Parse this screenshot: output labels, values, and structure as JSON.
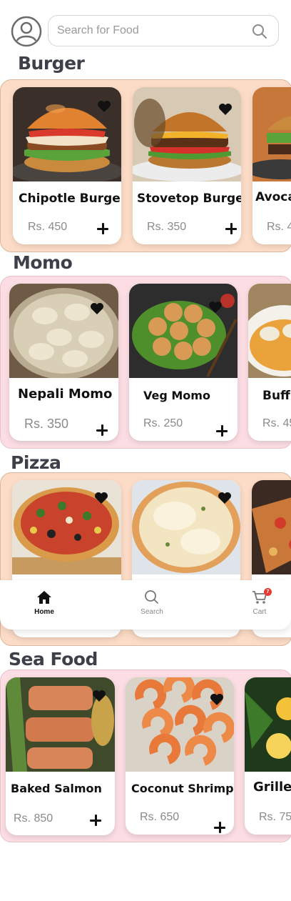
{
  "header": {
    "avatar_icon": "user-circle-icon",
    "search_placeholder": "Search for Food",
    "search_icon": "search-icon"
  },
  "sections": [
    {
      "title": "Burger",
      "items": [
        {
          "name": "Chipotle Burger",
          "price": "Rs. 450"
        },
        {
          "name": "Stovetop Burger",
          "price": "Rs. 350"
        },
        {
          "name": "Avoca",
          "price": "Rs. 4"
        }
      ]
    },
    {
      "title": "Momo",
      "items": [
        {
          "name": "Nepali Momo",
          "price": "Rs. 350"
        },
        {
          "name": "Veg Momo",
          "price": "Rs. 250"
        },
        {
          "name": "Buff",
          "price": "Rs. 45"
        }
      ]
    },
    {
      "title": "Pizza",
      "items": [
        {
          "name": "",
          "price": ""
        },
        {
          "name": "",
          "price": ""
        },
        {
          "name": "",
          "price": ""
        }
      ]
    },
    {
      "title": "Sea Food",
      "items": [
        {
          "name": "Baked Salmon",
          "price": "Rs. 850"
        },
        {
          "name": "Coconut Shrimp",
          "price": "Rs. 650"
        },
        {
          "name": "Grilled",
          "price": "Rs. 75"
        }
      ]
    }
  ],
  "nav": {
    "home": "Home",
    "search": "Search",
    "cart": "Cart",
    "cart_badge": "7"
  },
  "colors": {
    "peach_panel": "#fcdcc6",
    "pink_panel": "#fbdde3",
    "title_text": "#3d4049",
    "badge": "#e53935"
  }
}
